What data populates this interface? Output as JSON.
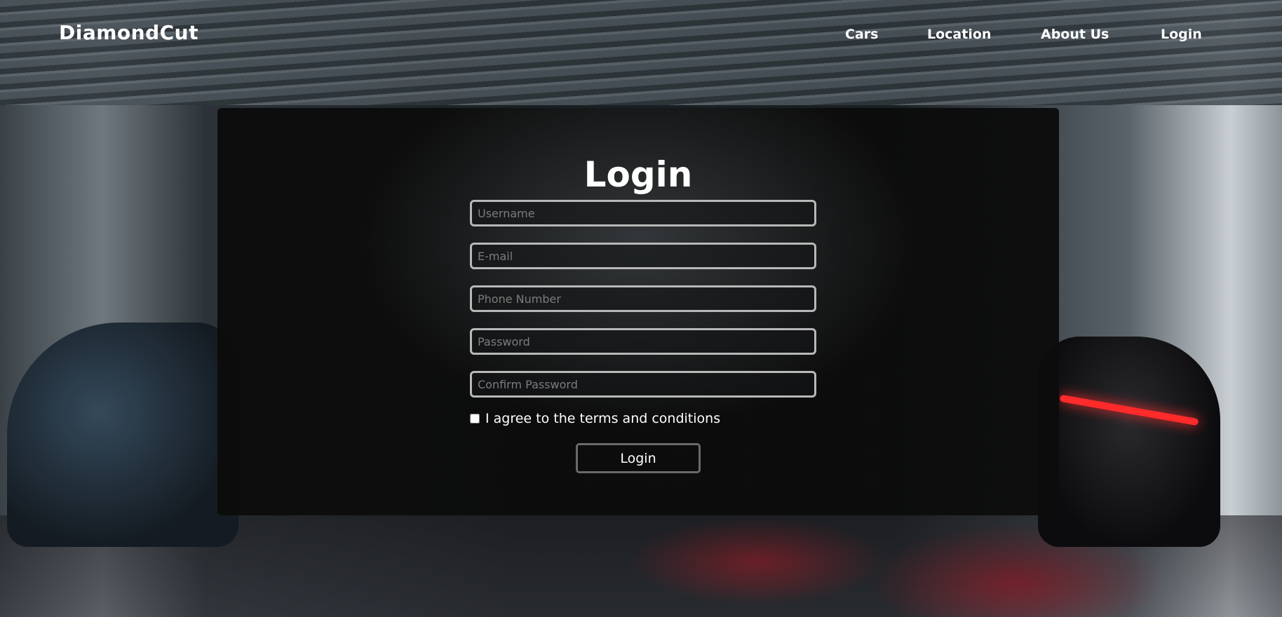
{
  "brand": "DiamondCut",
  "nav": [
    "Cars",
    "Location",
    "About Us",
    "Login"
  ],
  "form": {
    "title": "Login",
    "placeholders": {
      "username": "Username",
      "email": "E-mail",
      "phone": "Phone Number",
      "password": "Password",
      "confirm": "Confirm Password"
    },
    "agree_label": "I agree to the terms and conditions",
    "agree_checked": false,
    "submit_label": "Login"
  }
}
